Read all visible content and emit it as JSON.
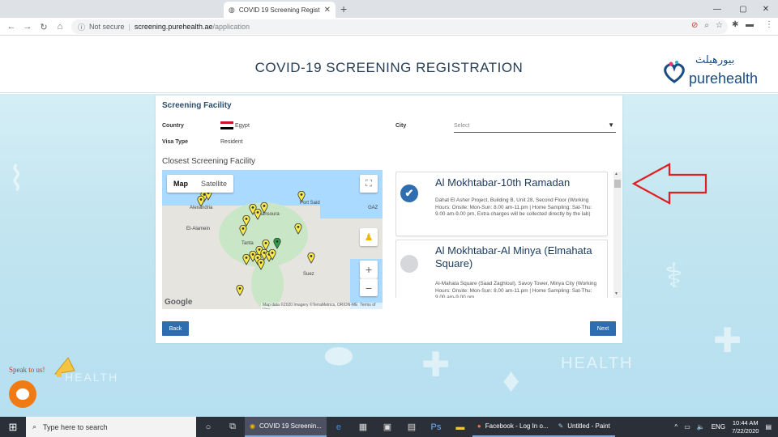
{
  "browser": {
    "tab_title": "COVID 19 Screening Registra",
    "address_label": "Not secure",
    "url_domain": "screening.purehealth.ae",
    "url_path": "/application"
  },
  "header": {
    "title": "COVID-19 SCREENING REGISTRATION",
    "logo_arabic": "بيورهيلث",
    "logo_english": "purehealth"
  },
  "form": {
    "section_title": "Screening Facility",
    "country_label": "Country",
    "country_value": "Egypt",
    "visa_label": "Visa Type",
    "visa_value": "Resident",
    "city_label": "City",
    "city_placeholder": "Select",
    "closest_label": "Closest Screening Facility",
    "back_label": "Back",
    "next_label": "Next"
  },
  "map": {
    "map_tab": "Map",
    "satellite_tab": "Satellite",
    "attribution": "Map data ©2020 Imagery ©TerraMetrics, ORION-ME",
    "terms": "Terms of Use",
    "google_label": "Google",
    "places": [
      "Alexandria",
      "Port Said",
      "Mansoura",
      "Tanta",
      "El-Alamein",
      "Suez",
      "GAZ"
    ]
  },
  "facilities": [
    {
      "name": "Al Mokhtabar-10th Ramadan",
      "address": "Dahat El Asher Project, Building B, Unit 28, Second Floor (Working Hours: Onsite: Mon-Sun: 8.00 am-11.pm | Home Sampling: Sat-Thu: 9.00 am-9.00 pm, Extra charges will be collected directly by the lab)",
      "selected": true
    },
    {
      "name": "Al Mokhtabar-Al Minya (Elmahata Square)",
      "address": "Al-Mahata Square (Saad Zaghloul), Savoy Tower, Minya City (Working Hours: Onsite: Mon-Sun: 8.00 am-11.pm | Home Sampling: Sat-Thu: 9.00 am-9.00 pm",
      "selected": false
    }
  ],
  "chat": {
    "speak_label": "Speak to us!"
  },
  "background": {
    "watermark_1": "HEALTH",
    "watermark_2": "HEALTH"
  },
  "taskbar": {
    "search_placeholder": "Type here to search",
    "apps": [
      {
        "label": "COVID 19 Screenin..."
      },
      {
        "label": "Facebook - Log In o..."
      },
      {
        "label": "Untitled - Paint"
      }
    ],
    "language": "ENG",
    "time": "10:44 AM",
    "date": "7/22/2020"
  },
  "colors": {
    "primary_button": "#2d6db0",
    "title_text": "#263f56",
    "annotation_arrow": "#e02020",
    "chat_button": "#f07b14"
  }
}
